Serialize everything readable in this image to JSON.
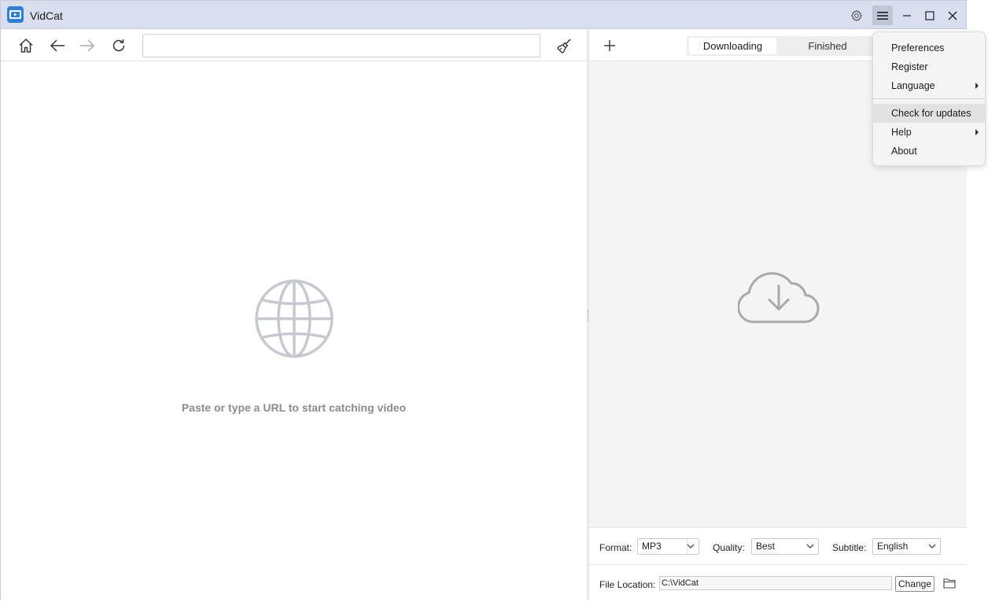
{
  "app": {
    "title": "VidCat"
  },
  "browser": {
    "url_value": "",
    "url_placeholder": "",
    "empty_message": "Paste or type a URL to start catching video"
  },
  "downloads": {
    "tabs": [
      {
        "label": "Downloading",
        "selected": true
      },
      {
        "label": "Finished",
        "selected": false
      }
    ],
    "format_label": "Format:",
    "format_value": "MP3",
    "quality_label": "Quality:",
    "quality_value": "Best",
    "subtitle_label": "Subtitle:",
    "subtitle_value": "English",
    "location_label": "File Location:",
    "location_value": "C:\\VidCat",
    "change_label": "Change"
  },
  "menu": {
    "items": [
      {
        "label": "Preferences"
      },
      {
        "label": "Register"
      },
      {
        "label": "Language",
        "submenu": true
      },
      {
        "label": "Check for updates",
        "highlighted": true
      },
      {
        "label": "Help",
        "submenu": true
      },
      {
        "label": "About"
      }
    ]
  },
  "colors": {
    "titlebar": "#d9dfee",
    "accent": "#2f7fd8",
    "muted_icon": "#c6c9cf"
  }
}
